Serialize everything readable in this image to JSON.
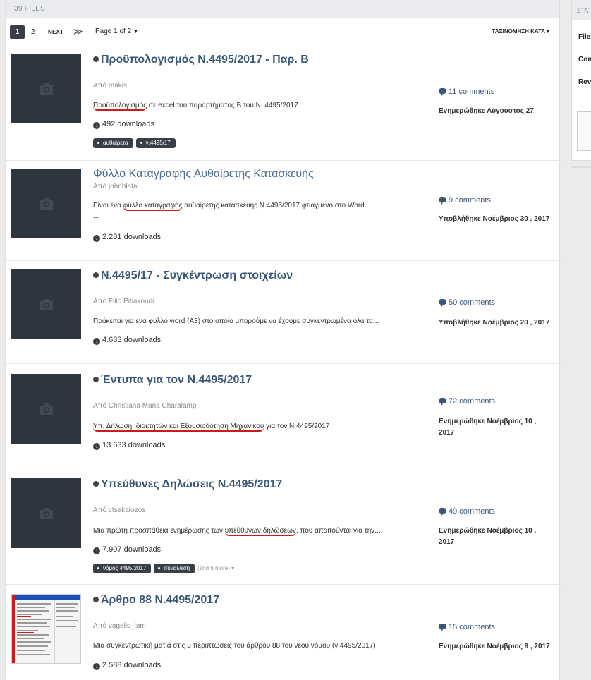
{
  "header": {
    "files_count": "39 FILES"
  },
  "pagination": {
    "active": "1",
    "page2": "2",
    "next": "NEXT",
    "last": "≫",
    "page_of": "Page 1 of 2",
    "sort": "ΤΑΞΙΝΟΜΗΣΗ ΚΑΤΑ"
  },
  "files": [
    {
      "title": "Προϋπολογισμός Ν.4495/2017 - Παρ. Β",
      "author": "Από makis",
      "desc_pre": "",
      "desc_u": "Προϋπολογισμός",
      "desc_post": " σε excel του παραρτήματος Β του Ν. 4495/2017",
      "desc_2": "",
      "downloads": "492 downloads",
      "comments": "11 comments",
      "updated": "Ενημερώθηκε Αύγουστος 27",
      "tag1": "αυθαίρετα",
      "tag2": "ν.4495/17",
      "more": ""
    },
    {
      "title": "Φύλλο Καταγραφής Αυθαίρετης Κατασκευής",
      "author": "Από johnblata",
      "desc_pre": "Είναι ένα ",
      "desc_u": "φύλλο καταγραφής",
      "desc_post": " αυθαίρετης κατασκευής Ν.4495/2017 φτιαγμένο στο Word",
      "desc_2": "...",
      "downloads": "2.281 downloads",
      "comments": "9 comments",
      "updated": "Υποβλήθηκε Νοέμβριος 30 , 2017",
      "tag1": "",
      "tag2": "",
      "more": ""
    },
    {
      "title": "Ν.4495/17 - Συγκέντρωση στοιχείων",
      "author": "Από Filio Pitiakoudi",
      "desc_pre": "Πρόκειται για ενα φυλλο word (Α3) στο οποίο μπορούμε να έχουμε συγκεντρωμένα όλα τα...",
      "desc_u": "",
      "desc_post": "",
      "desc_2": "",
      "downloads": "4.683 downloads",
      "comments": "50 comments",
      "updated": "Υποβλήθηκε Νοέμβριος 20 , 2017",
      "tag1": "",
      "tag2": "",
      "more": ""
    },
    {
      "title": "Έντυπα για τον Ν.4495/2017",
      "author": "Από Christiana Maria Charalampi",
      "desc_pre": "",
      "desc_u": "Υπ. Δήλωση Ιδιοκτητών και Εξουσιοδότηση Μηχανικού",
      "desc_post": " για τον Ν.4495/2017",
      "desc_2": "",
      "downloads": "13.633 downloads",
      "comments": "72 comments",
      "updated": "Ενημερώθηκε Νοέμβριος 10 , 2017",
      "tag1": "",
      "tag2": "",
      "more": ""
    },
    {
      "title": "Υπεύθυνες Δηλώσεις Ν.4495/2017",
      "author": "Από ctsakalozos",
      "desc_pre": "Μια πρώτη προσπάθεια ενημέρωσης των ",
      "desc_u": "υπεύθυνων δηλώσεων",
      "desc_post": ", που απαιτούνται για την...",
      "desc_2": "",
      "downloads": "7.907 downloads",
      "comments": "49 comments",
      "updated": "Ενημερώθηκε Νοέμβριος 10 , 2017",
      "tag1": "νόμος 4495/2017",
      "tag2": "συναίνεση",
      "more": "(and 6 more) ▾"
    },
    {
      "title": "Άρθρο 88 Ν.4495/2017",
      "author": "Από vagelis_lam",
      "desc_pre": "Μια συγκεντρωτική ματιά στις 3 περιπτώσεις του άρθρου 88 του νέου νόμου (ν.4495/2017)",
      "desc_u": "",
      "desc_post": "",
      "desc_2": "",
      "downloads": "2.588 downloads",
      "comments": "15 comments",
      "updated": "Ενημερώθηκε Νοέμβριος 9 , 2017",
      "tag1": "",
      "tag2": "",
      "more": ""
    }
  ],
  "sidebar": {
    "head": "ΣΤΑΤ",
    "item1": "Files",
    "item2": "Comments",
    "item3": "Reviews"
  }
}
